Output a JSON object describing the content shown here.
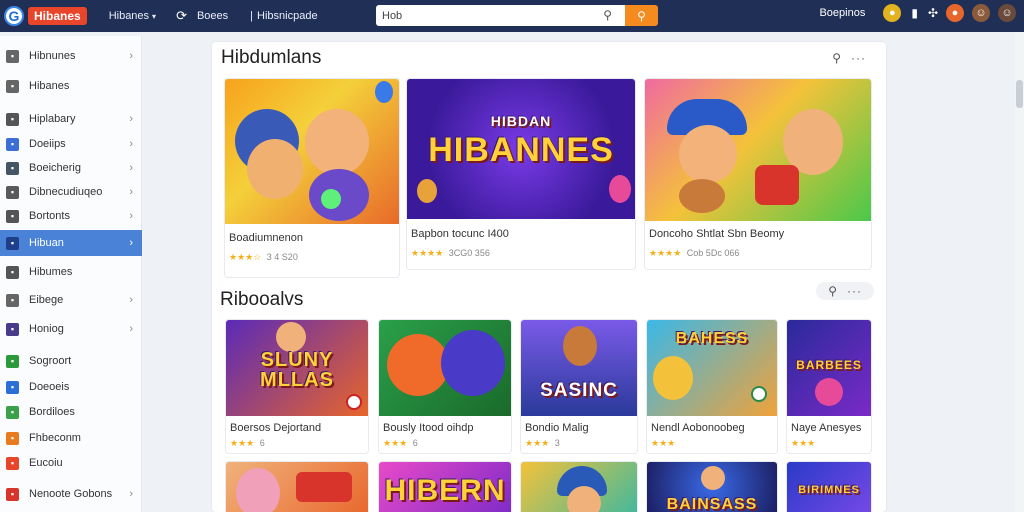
{
  "brand": {
    "logo_letter": "G",
    "name": "Hibanes"
  },
  "nav": {
    "item1": "Hibanes",
    "item2": "Boees",
    "item3": "Hibsnicpade"
  },
  "search": {
    "value": "Hob",
    "placeholder": ""
  },
  "user": {
    "label": "Boepinos"
  },
  "sidebar": {
    "items": [
      {
        "label": "Hibnunes",
        "color": "#555555",
        "chevron": true
      },
      {
        "label": "Hibanes",
        "color": "#555555",
        "chevron": false
      },
      {
        "label": "Hiplabary",
        "color": "#444444",
        "chevron": true
      },
      {
        "label": "Doeiips",
        "color": "#3b6fd6",
        "chevron": true
      },
      {
        "label": "Boeicherig",
        "color": "#445566",
        "chevron": true
      },
      {
        "label": "Dibnecudiuqeo",
        "color": "#5a5a5a",
        "chevron": true
      },
      {
        "label": "Bortonts",
        "color": "#555555",
        "chevron": true
      },
      {
        "label": "Hibuan",
        "color": "#1f3f8a",
        "chevron": true
      },
      {
        "label": "Hibumes",
        "color": "#555555",
        "chevron": false
      },
      {
        "label": "Eibege",
        "color": "#666666",
        "chevron": true
      },
      {
        "label": "Honiog",
        "color": "#4a3a8a",
        "chevron": true
      },
      {
        "label": "Sogroort",
        "color": "#2a9a3a",
        "chevron": false
      },
      {
        "label": "Doeoeis",
        "color": "#2a6fd6",
        "chevron": false
      },
      {
        "label": "Bordiloes",
        "color": "#3aa04a",
        "chevron": false
      },
      {
        "label": "Fhbeconm",
        "color": "#e87a1f",
        "chevron": false
      },
      {
        "label": "Eucoiu",
        "color": "#e8452b",
        "chevron": false
      },
      {
        "label": "Nenoote Gobons",
        "color": "#d8342b",
        "chevron": true
      }
    ]
  },
  "section1": {
    "title": "Hibdumlans",
    "cards": [
      {
        "title": "Boadiumnenon",
        "rating": "3 4 S20",
        "stars": "★★★☆"
      },
      {
        "title": "Bapbon tocunc I400",
        "rating": "3CG0 356",
        "stars": "★★★★",
        "banner": "HIBANNES",
        "banner_small": "HIBDAN"
      },
      {
        "title": "Doncoho Shtlat Sbn Beomy",
        "rating": "Cob 5Dc 066",
        "stars": "★★★★"
      }
    ]
  },
  "section2": {
    "title": "Ribooalvs",
    "cards": [
      {
        "title": "Boersos Dejortand",
        "rating": "6",
        "stars": "★★★",
        "banner": "SLUNY MLLAS"
      },
      {
        "title": "Bously Itood oihdp",
        "rating": "6",
        "stars": "★★★",
        "banner": ""
      },
      {
        "title": "Bondio Malig",
        "rating": "3",
        "stars": "★★★",
        "banner": "SASINC"
      },
      {
        "title": "Nendl Aobonoobeg",
        "rating": "",
        "stars": "★★★",
        "banner": "BAHESS"
      },
      {
        "title": "Naye Anesyes",
        "rating": "",
        "stars": "★★★",
        "banner": "BARBEES"
      }
    ]
  },
  "section3": {
    "cards": [
      {
        "banner": ""
      },
      {
        "banner": "HIBERN"
      },
      {
        "banner": ""
      },
      {
        "banner": "BAINSASS"
      },
      {
        "banner": "BIRIMNES"
      }
    ]
  },
  "colors": {
    "topbar": "#1f2f56",
    "accent": "#f58b1f",
    "active": "#4a82d8",
    "star": "#f4b01b"
  }
}
